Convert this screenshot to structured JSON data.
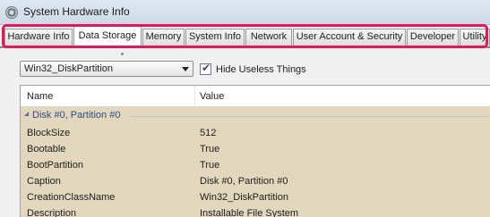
{
  "window": {
    "title": "System Hardware Info",
    "icon": "gear-app-icon"
  },
  "tabs": [
    {
      "label": "Hardware Info",
      "active": false
    },
    {
      "label": "Data Storage",
      "active": true
    },
    {
      "label": "Memory",
      "active": false
    },
    {
      "label": "System Info",
      "active": false
    },
    {
      "label": "Network",
      "active": false
    },
    {
      "label": "User Account & Security",
      "active": false
    },
    {
      "label": "Developer",
      "active": false
    },
    {
      "label": "Utility",
      "active": false
    }
  ],
  "toolbar": {
    "class_select_value": "Win32_DiskPartition",
    "hide_checkbox_checked": true,
    "hide_checkbox_label": "Hide Useless Things"
  },
  "grid": {
    "columns": {
      "name": "Name",
      "value": "Value"
    },
    "group_label": "Disk #0, Partition #0",
    "rows": [
      {
        "name": "BlockSize",
        "value": "512"
      },
      {
        "name": "Bootable",
        "value": "True"
      },
      {
        "name": "BootPartition",
        "value": "True"
      },
      {
        "name": "Caption",
        "value": "Disk #0, Partition #0"
      },
      {
        "name": "CreationClassName",
        "value": "Win32_DiskPartition"
      },
      {
        "name": "Description",
        "value": "Installable File System"
      }
    ]
  },
  "colors": {
    "highlight": "#e0195b",
    "grid_background": "#e2d6bd",
    "group_text": "#2d4f8a"
  }
}
